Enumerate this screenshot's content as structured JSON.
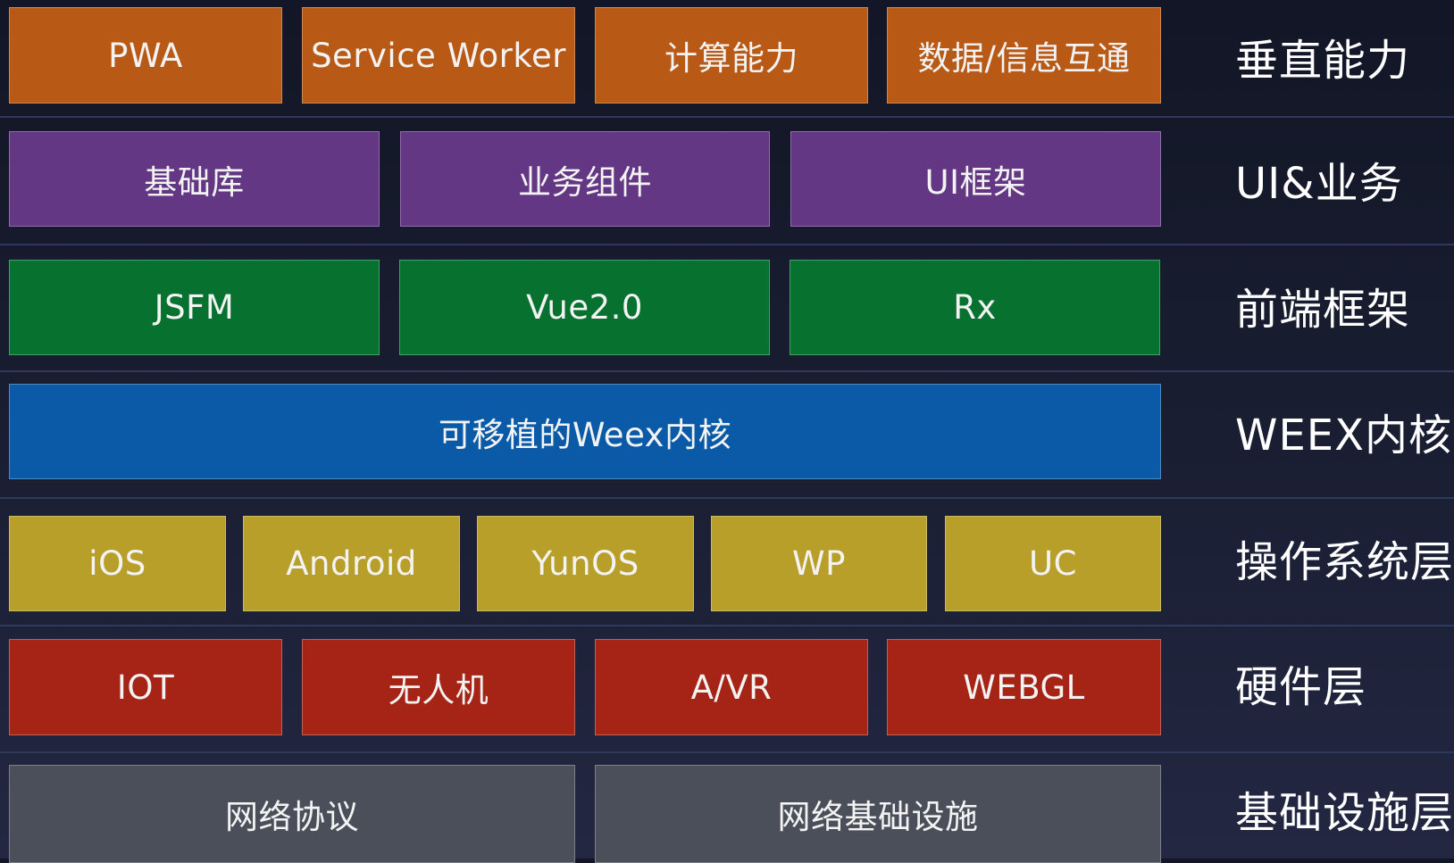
{
  "colors": {
    "orange": "#b85a16",
    "purple": "#633784",
    "green": "#07722f",
    "blue": "#0b5aa8",
    "yellow": "#b89f2a",
    "red": "#a52416",
    "gray": "#4a4f5a"
  },
  "layers": [
    {
      "label": "垂直能力",
      "color": "orange",
      "blocks": [
        "PWA",
        "Service Worker",
        "计算能力",
        "数据/信息互通"
      ]
    },
    {
      "label": "UI&业务",
      "color": "purple",
      "blocks": [
        "基础库",
        "业务组件",
        "UI框架"
      ]
    },
    {
      "label": "前端框架",
      "color": "green",
      "blocks": [
        "JSFM",
        "Vue2.0",
        "Rx"
      ]
    },
    {
      "label": "WEEX内核",
      "color": "blue",
      "blocks": [
        "可移植的Weex内核"
      ]
    },
    {
      "label": "操作系统层",
      "color": "yellow",
      "blocks": [
        "iOS",
        "Android",
        "YunOS",
        "WP",
        "UC"
      ]
    },
    {
      "label": "硬件层",
      "color": "red",
      "blocks": [
        "IOT",
        "无人机",
        "A/VR",
        "WEBGL"
      ]
    },
    {
      "label": "基础设施层",
      "color": "gray",
      "blocks": [
        "网络协议",
        "网络基础设施"
      ]
    }
  ]
}
